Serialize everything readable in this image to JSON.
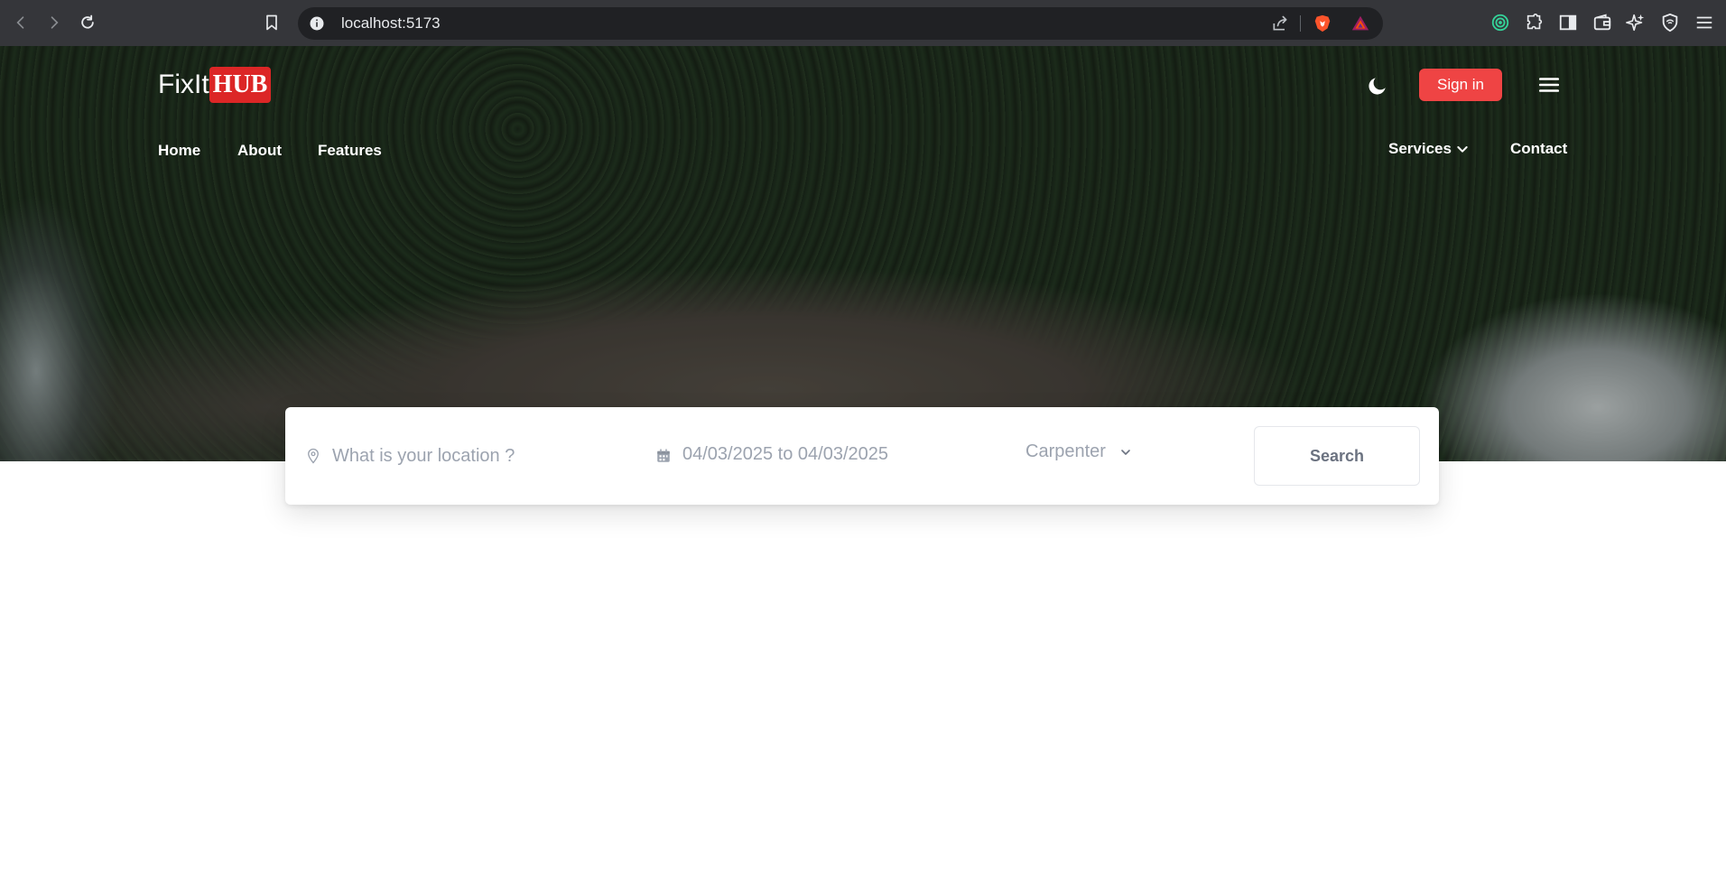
{
  "browser": {
    "url": "localhost:5173"
  },
  "brand": {
    "name_part1": "FixIt",
    "name_part2": "HUB",
    "accent": "#dc2626"
  },
  "header": {
    "signin_label": "Sign in",
    "nav_left": [
      "Home",
      "About",
      "Features"
    ],
    "services_label": "Services",
    "contact_label": "Contact"
  },
  "search": {
    "location_placeholder": "What is your location ?",
    "date_range": "04/03/2025 to 04/03/2025",
    "category": "Carpenter",
    "button_label": "Search"
  },
  "colors": {
    "signin_bg": "#ef4444",
    "chrome_bg": "#35363a"
  }
}
